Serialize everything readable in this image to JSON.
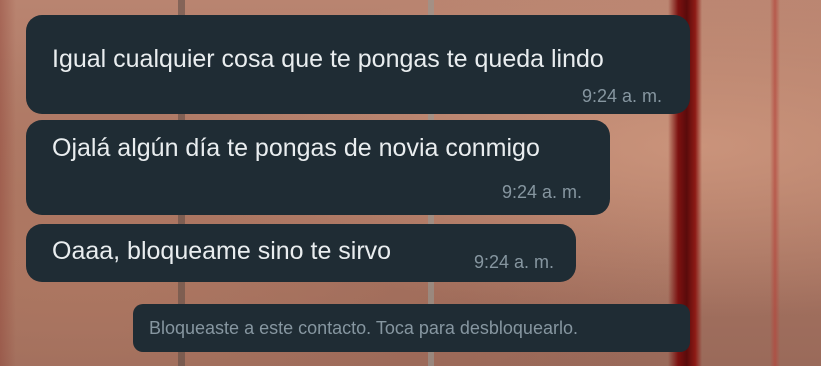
{
  "chat": {
    "messages": [
      {
        "text": "Igual cualquier cosa que te pongas te queda lindo",
        "time": "9:24 a. m."
      },
      {
        "text": "Ojalá algún día te pongas de novia conmigo",
        "time": "9:24 a. m."
      },
      {
        "text": "Oaaa, bloqueame sino te sirvo",
        "time": "9:24 a. m."
      }
    ],
    "blocked_notice": "Bloqueaste a este contacto. Toca para desbloquearlo."
  },
  "colors": {
    "bubble_background": "#1f2c34",
    "message_text": "#e9edef",
    "timestamp_text": "#8696a0"
  }
}
